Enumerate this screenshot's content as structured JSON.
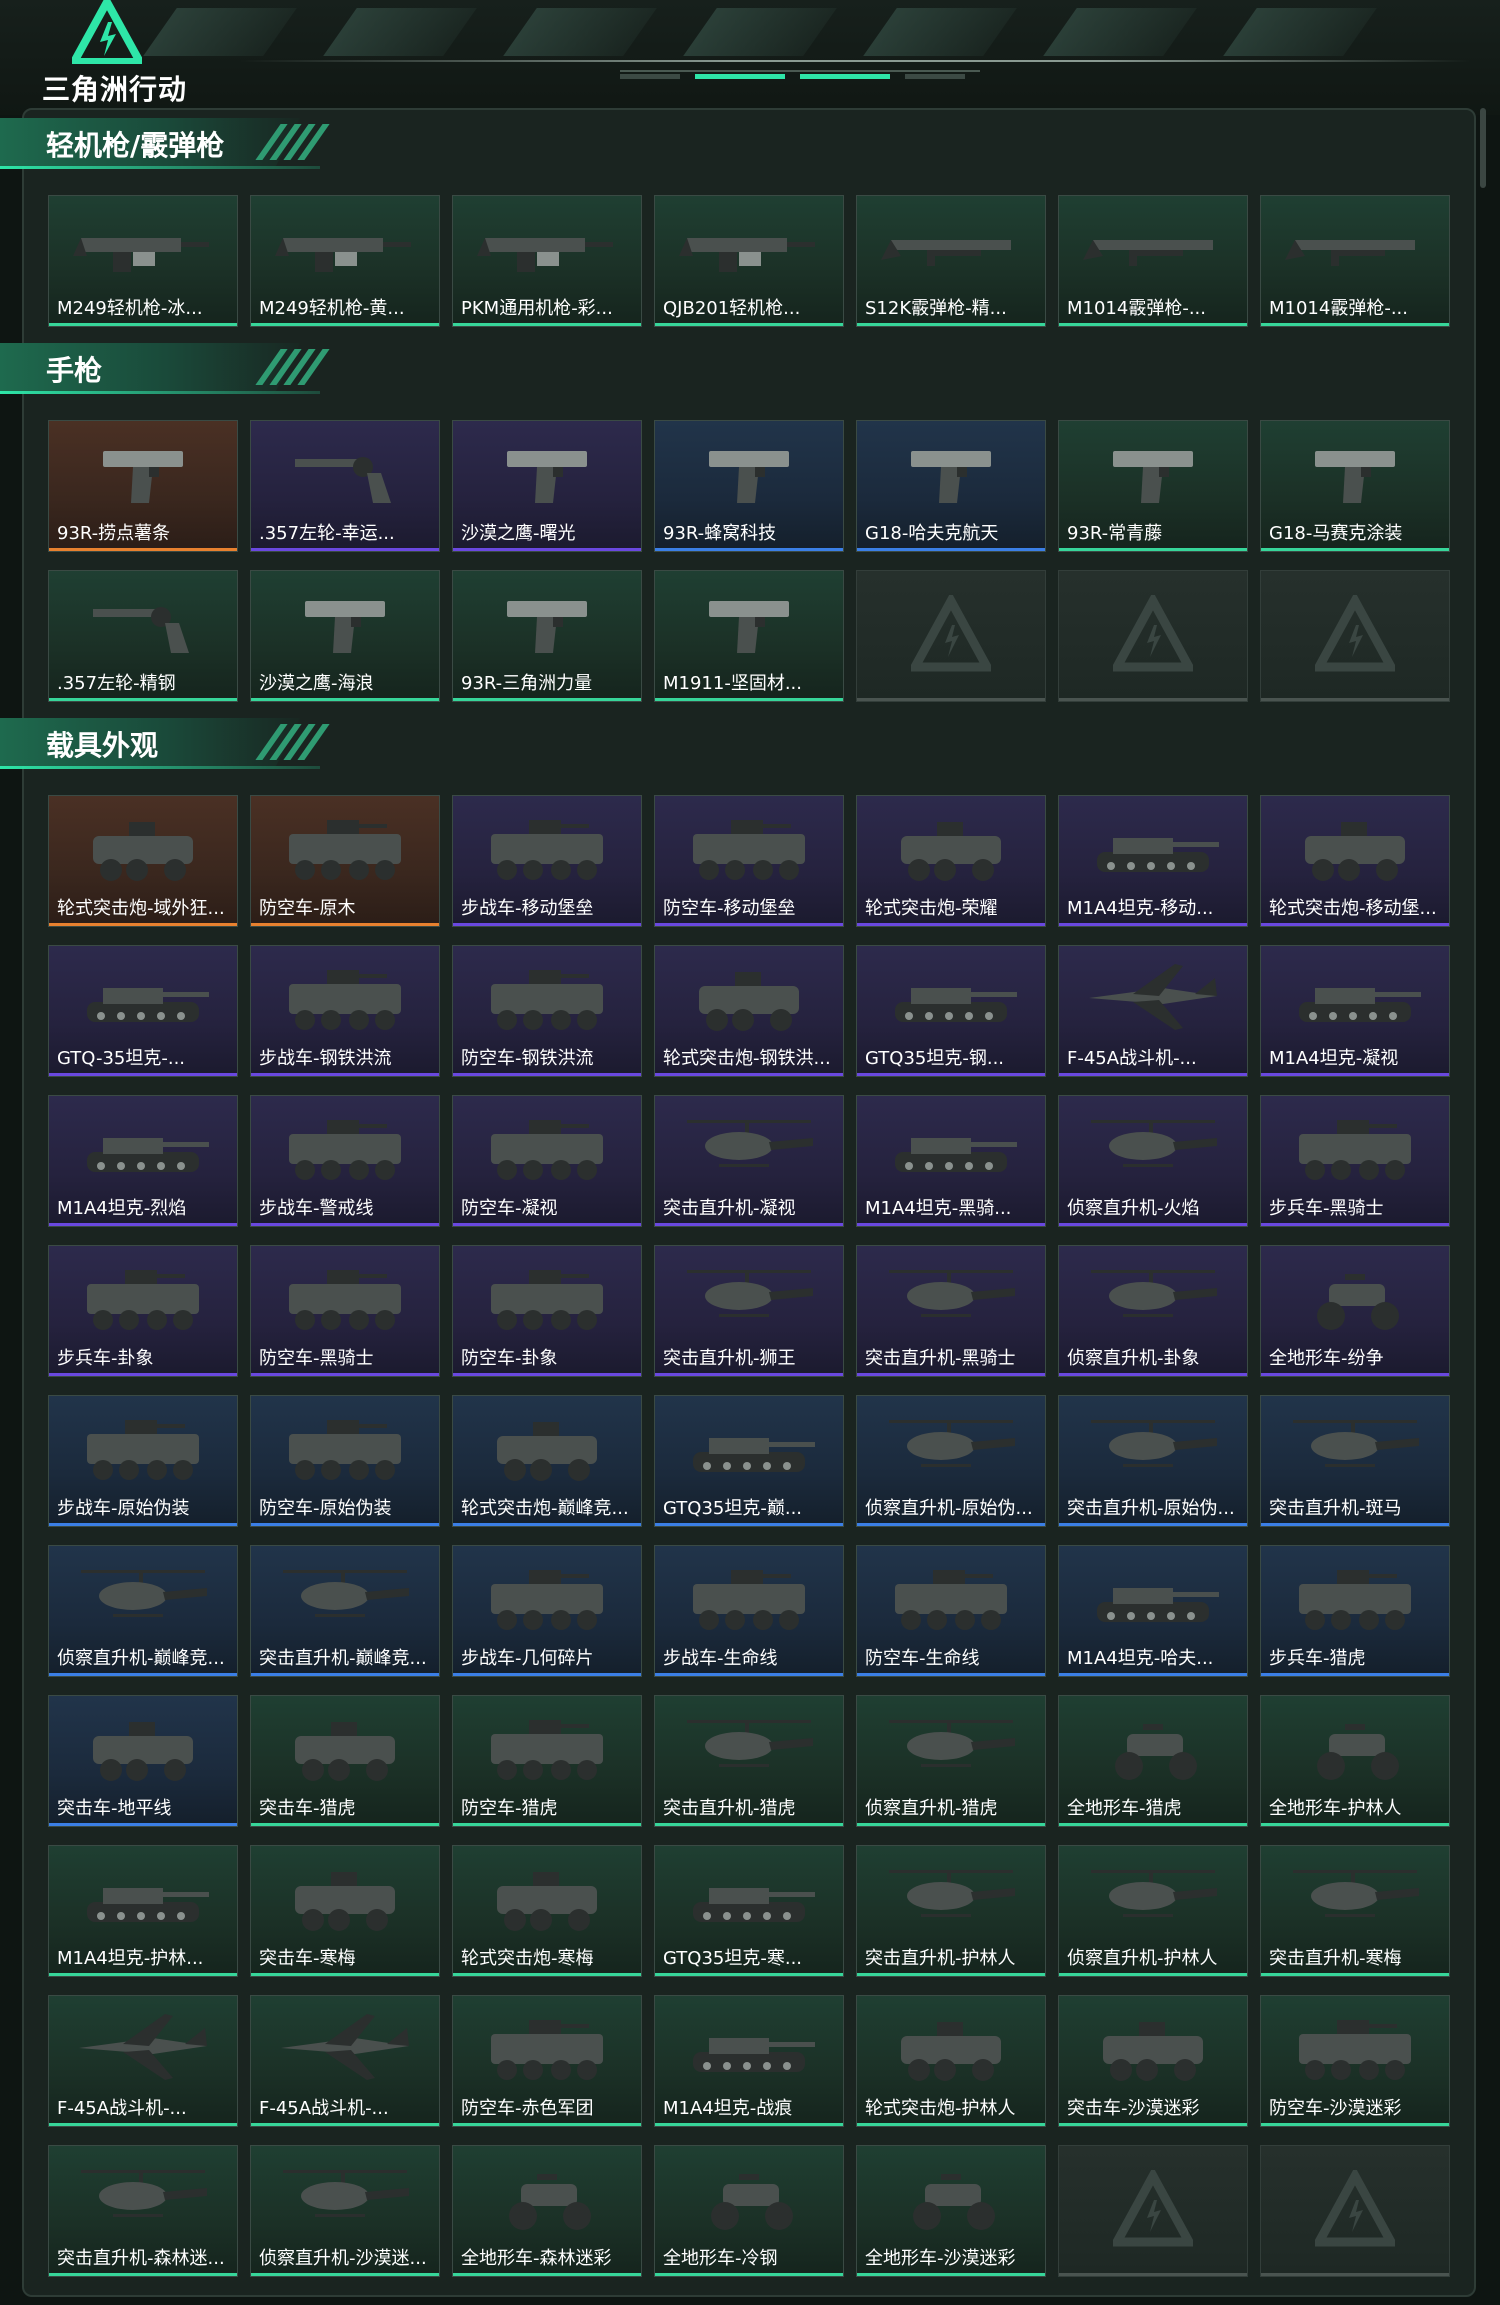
{
  "app": {
    "brand": "三角洲行动"
  },
  "sections": [
    {
      "title": "轻机枪/霰弹枪",
      "items": [
        {
          "label": "M249轻机枪-冰...",
          "rarity": "green",
          "icon": "lmg-icon"
        },
        {
          "label": "M249轻机枪-黄...",
          "rarity": "green",
          "icon": "lmg-icon"
        },
        {
          "label": "PKM通用机枪-彩...",
          "rarity": "green",
          "icon": "lmg-icon"
        },
        {
          "label": "QJB201轻机枪...",
          "rarity": "green",
          "icon": "lmg-icon"
        },
        {
          "label": "S12K霰弹枪-精...",
          "rarity": "green",
          "icon": "shotgun-icon"
        },
        {
          "label": "M1014霰弹枪-...",
          "rarity": "green",
          "icon": "shotgun-icon"
        },
        {
          "label": "M1014霰弹枪-...",
          "rarity": "green",
          "icon": "shotgun-icon"
        }
      ]
    },
    {
      "title": "手枪",
      "items": [
        {
          "label": "93R-捞点薯条",
          "rarity": "orange",
          "icon": "pistol-icon"
        },
        {
          "label": ".357左轮-幸运...",
          "rarity": "purple",
          "icon": "revolver-icon"
        },
        {
          "label": "沙漠之鹰-曙光",
          "rarity": "purple",
          "icon": "pistol-icon"
        },
        {
          "label": "93R-蜂窝科技",
          "rarity": "blue",
          "icon": "pistol-icon"
        },
        {
          "label": "G18-哈夫克航天",
          "rarity": "blue",
          "icon": "pistol-icon"
        },
        {
          "label": "93R-常青藤",
          "rarity": "green",
          "icon": "pistol-icon"
        },
        {
          "label": "G18-马赛克涂装",
          "rarity": "green",
          "icon": "pistol-icon"
        },
        {
          "label": ".357左轮-精钢",
          "rarity": "green",
          "icon": "revolver-icon"
        },
        {
          "label": "沙漠之鹰-海浪",
          "rarity": "green",
          "icon": "pistol-icon"
        },
        {
          "label": "93R-三角洲力量",
          "rarity": "green",
          "icon": "pistol-icon"
        },
        {
          "label": "M1911-坚固材...",
          "rarity": "green",
          "icon": "pistol-icon"
        }
      ],
      "empty_slots": 3
    },
    {
      "title": "载具外观",
      "items": [
        {
          "label": "轮式突击炮-域外狂...",
          "rarity": "orange",
          "icon": "armored-car-icon"
        },
        {
          "label": "防空车-原木",
          "rarity": "orange",
          "icon": "apc-icon"
        },
        {
          "label": "步战车-移动堡垒",
          "rarity": "purple",
          "icon": "apc-icon"
        },
        {
          "label": "防空车-移动堡垒",
          "rarity": "purple",
          "icon": "apc-icon"
        },
        {
          "label": "轮式突击炮-荣耀",
          "rarity": "purple",
          "icon": "armored-car-icon"
        },
        {
          "label": "M1A4坦克-移动...",
          "rarity": "purple",
          "icon": "tank-icon"
        },
        {
          "label": "轮式突击炮-移动堡...",
          "rarity": "purple",
          "icon": "armored-car-icon"
        },
        {
          "label": "GTQ-35坦克-...",
          "rarity": "purple",
          "icon": "tank-icon"
        },
        {
          "label": "步战车-钢铁洪流",
          "rarity": "purple",
          "icon": "apc-icon"
        },
        {
          "label": "防空车-钢铁洪流",
          "rarity": "purple",
          "icon": "apc-icon"
        },
        {
          "label": "轮式突击炮-钢铁洪...",
          "rarity": "purple",
          "icon": "armored-car-icon"
        },
        {
          "label": "GTQ35坦克-钢...",
          "rarity": "purple",
          "icon": "tank-icon"
        },
        {
          "label": "F-45A战斗机-...",
          "rarity": "purple",
          "icon": "jet-icon"
        },
        {
          "label": "M1A4坦克-凝视",
          "rarity": "purple",
          "icon": "tank-icon"
        },
        {
          "label": "M1A4坦克-烈焰",
          "rarity": "purple",
          "icon": "tank-icon"
        },
        {
          "label": "步战车-警戒线",
          "rarity": "purple",
          "icon": "apc-icon"
        },
        {
          "label": "防空车-凝视",
          "rarity": "purple",
          "icon": "apc-icon"
        },
        {
          "label": "突击直升机-凝视",
          "rarity": "purple",
          "icon": "helicopter-icon"
        },
        {
          "label": "M1A4坦克-黑骑...",
          "rarity": "purple",
          "icon": "tank-icon"
        },
        {
          "label": "侦察直升机-火焰",
          "rarity": "purple",
          "icon": "helicopter-icon"
        },
        {
          "label": "步兵车-黑骑士",
          "rarity": "purple",
          "icon": "apc-icon"
        },
        {
          "label": "步兵车-卦象",
          "rarity": "purple",
          "icon": "apc-icon"
        },
        {
          "label": "防空车-黑骑士",
          "rarity": "purple",
          "icon": "apc-icon"
        },
        {
          "label": "防空车-卦象",
          "rarity": "purple",
          "icon": "apc-icon"
        },
        {
          "label": "突击直升机-狮王",
          "rarity": "purple",
          "icon": "helicopter-icon"
        },
        {
          "label": "突击直升机-黑骑士",
          "rarity": "purple",
          "icon": "helicopter-icon"
        },
        {
          "label": "侦察直升机-卦象",
          "rarity": "purple",
          "icon": "helicopter-icon"
        },
        {
          "label": "全地形车-纷争",
          "rarity": "purple",
          "icon": "atv-icon"
        },
        {
          "label": "步战车-原始伪装",
          "rarity": "blue",
          "icon": "apc-icon"
        },
        {
          "label": "防空车-原始伪装",
          "rarity": "blue",
          "icon": "apc-icon"
        },
        {
          "label": "轮式突击炮-巅峰竞...",
          "rarity": "blue",
          "icon": "armored-car-icon"
        },
        {
          "label": "GTQ35坦克-巅...",
          "rarity": "blue",
          "icon": "tank-icon"
        },
        {
          "label": "侦察直升机-原始伪...",
          "rarity": "blue",
          "icon": "helicopter-icon"
        },
        {
          "label": "突击直升机-原始伪...",
          "rarity": "blue",
          "icon": "helicopter-icon"
        },
        {
          "label": "突击直升机-斑马",
          "rarity": "blue",
          "icon": "helicopter-icon"
        },
        {
          "label": "侦察直升机-巅峰竞...",
          "rarity": "blue",
          "icon": "helicopter-icon"
        },
        {
          "label": "突击直升机-巅峰竞...",
          "rarity": "blue",
          "icon": "helicopter-icon"
        },
        {
          "label": "步战车-几何碎片",
          "rarity": "blue",
          "icon": "apc-icon"
        },
        {
          "label": "步战车-生命线",
          "rarity": "blue",
          "icon": "apc-icon"
        },
        {
          "label": "防空车-生命线",
          "rarity": "blue",
          "icon": "apc-icon"
        },
        {
          "label": "M1A4坦克-哈夫...",
          "rarity": "blue",
          "icon": "tank-icon"
        },
        {
          "label": "步兵车-猎虎",
          "rarity": "blue",
          "icon": "apc-icon"
        },
        {
          "label": "突击车-地平线",
          "rarity": "blue",
          "icon": "armored-car-icon"
        },
        {
          "label": "突击车-猎虎",
          "rarity": "green",
          "icon": "armored-car-icon"
        },
        {
          "label": "防空车-猎虎",
          "rarity": "green",
          "icon": "apc-icon"
        },
        {
          "label": "突击直升机-猎虎",
          "rarity": "green",
          "icon": "helicopter-icon"
        },
        {
          "label": "侦察直升机-猎虎",
          "rarity": "green",
          "icon": "helicopter-icon"
        },
        {
          "label": "全地形车-猎虎",
          "rarity": "green",
          "icon": "atv-icon"
        },
        {
          "label": "全地形车-护林人",
          "rarity": "green",
          "icon": "atv-icon"
        },
        {
          "label": "M1A4坦克-护林...",
          "rarity": "green",
          "icon": "tank-icon"
        },
        {
          "label": "突击车-寒梅",
          "rarity": "green",
          "icon": "armored-car-icon"
        },
        {
          "label": "轮式突击炮-寒梅",
          "rarity": "green",
          "icon": "armored-car-icon"
        },
        {
          "label": "GTQ35坦克-寒...",
          "rarity": "green",
          "icon": "tank-icon"
        },
        {
          "label": "突击直升机-护林人",
          "rarity": "green",
          "icon": "helicopter-icon"
        },
        {
          "label": "侦察直升机-护林人",
          "rarity": "green",
          "icon": "helicopter-icon"
        },
        {
          "label": "突击直升机-寒梅",
          "rarity": "green",
          "icon": "helicopter-icon"
        },
        {
          "label": "F-45A战斗机-...",
          "rarity": "green",
          "icon": "jet-icon"
        },
        {
          "label": "F-45A战斗机-...",
          "rarity": "green",
          "icon": "jet-icon"
        },
        {
          "label": "防空车-赤色军团",
          "rarity": "green",
          "icon": "apc-icon"
        },
        {
          "label": "M1A4坦克-战痕",
          "rarity": "green",
          "icon": "tank-icon"
        },
        {
          "label": "轮式突击炮-护林人",
          "rarity": "green",
          "icon": "armored-car-icon"
        },
        {
          "label": "突击车-沙漠迷彩",
          "rarity": "green",
          "icon": "armored-car-icon"
        },
        {
          "label": "防空车-沙漠迷彩",
          "rarity": "green",
          "icon": "apc-icon"
        },
        {
          "label": "突击直升机-森林迷...",
          "rarity": "green",
          "icon": "helicopter-icon"
        },
        {
          "label": "侦察直升机-沙漠迷...",
          "rarity": "green",
          "icon": "helicopter-icon"
        },
        {
          "label": "全地形车-森林迷彩",
          "rarity": "green",
          "icon": "atv-icon"
        },
        {
          "label": "全地形车-冷钢",
          "rarity": "green",
          "icon": "atv-icon"
        },
        {
          "label": "全地形车-沙漠迷彩",
          "rarity": "green",
          "icon": "atv-icon"
        }
      ],
      "empty_slots": 2
    }
  ],
  "colors": {
    "accent": "#2ee6a8",
    "rarity_green": "#37d69a",
    "rarity_blue": "#3b7fe6",
    "rarity_purple": "#6a48e0",
    "rarity_orange": "#e8812f"
  }
}
